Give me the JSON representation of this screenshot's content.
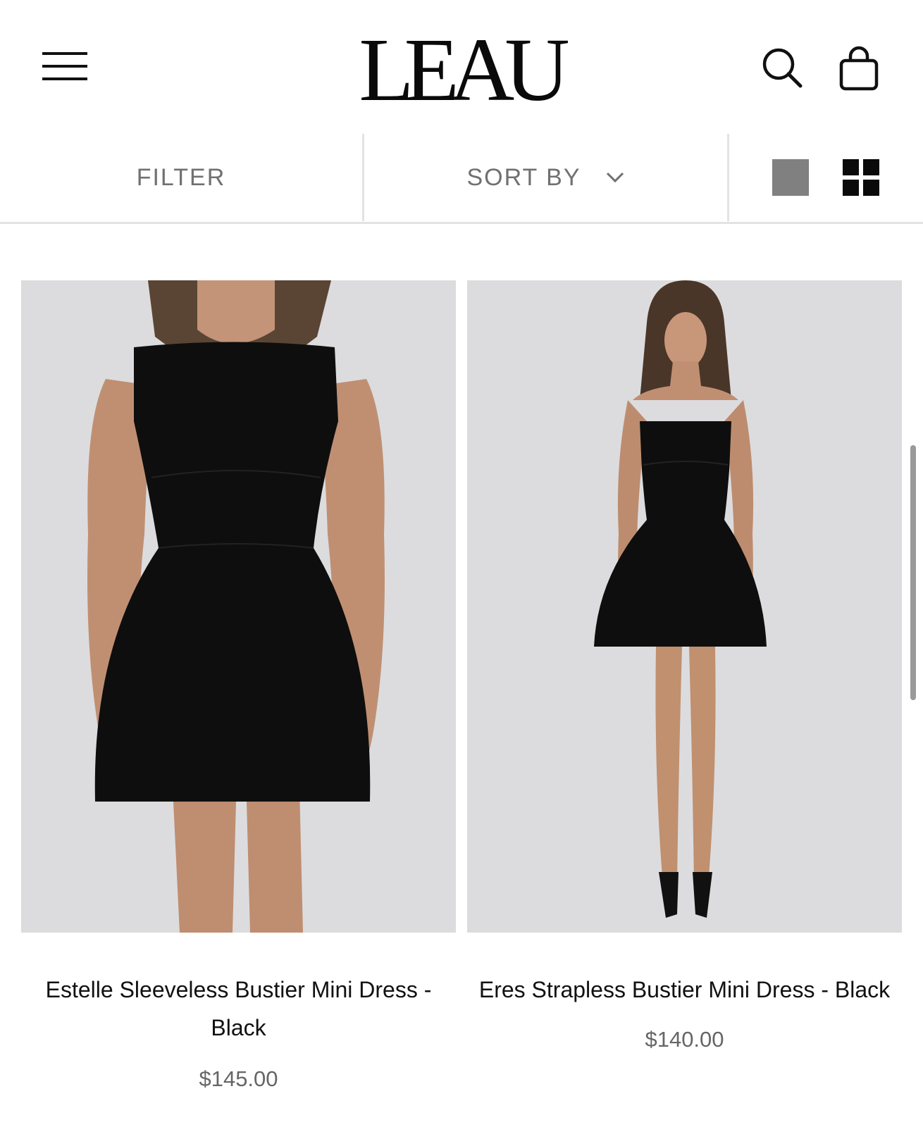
{
  "header": {
    "brand": "LEAU",
    "menu_icon": "hamburger-menu-icon",
    "search_icon": "search-icon",
    "bag_icon": "shopping-bag-icon"
  },
  "toolbar": {
    "filter_label": "FILTER",
    "sort_label": "SORT BY",
    "sort_icon": "chevron-down-icon",
    "view_options": [
      "single-column-view-icon",
      "grid-view-icon"
    ],
    "active_view": "grid-view-icon"
  },
  "products": [
    {
      "name": "Estelle Sleeveless Bustier Mini Dress - Black",
      "price": "$145.00"
    },
    {
      "name": "Eres Strapless Bustier Mini Dress - Black",
      "price": "$140.00"
    }
  ],
  "colors": {
    "text": "#111111",
    "muted": "#707070",
    "price": "#666666",
    "divider": "#e3e3e3",
    "image_bg": "#dcdcde",
    "inactive_view": "#808080"
  }
}
